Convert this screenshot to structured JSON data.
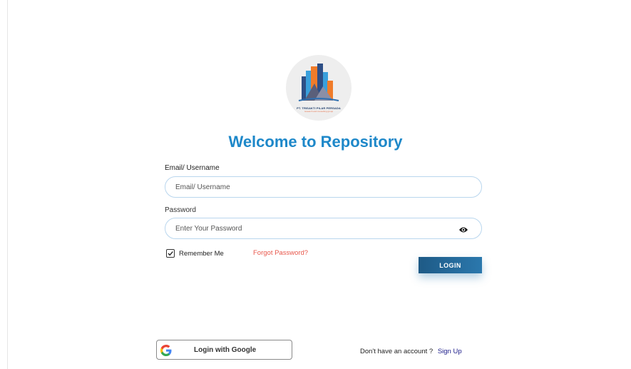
{
  "logo": {
    "company_name": "PT. TRISAKTI PILAR PERSADA",
    "tagline": "research and consulting group",
    "icon": "building-logo"
  },
  "title": "Welcome to Repository",
  "form": {
    "email_label": "Email/ Username",
    "email_placeholder": "Email/ Username",
    "password_label": "Password",
    "password_placeholder": "Enter Your Password",
    "remember_label": "Remember Me",
    "remember_checked": true,
    "forgot_label": "Forgot Password?",
    "login_label": "LOGIN"
  },
  "google": {
    "label": "Login with Google",
    "icon": "google-icon"
  },
  "signup": {
    "prompt": "Don't have an account ?",
    "link_label": "Sign Up"
  },
  "colors": {
    "title": "#1e88c9",
    "forgot": "#e8574b",
    "login_button": "#1e5a86",
    "signup_link": "#1c1c8a"
  }
}
